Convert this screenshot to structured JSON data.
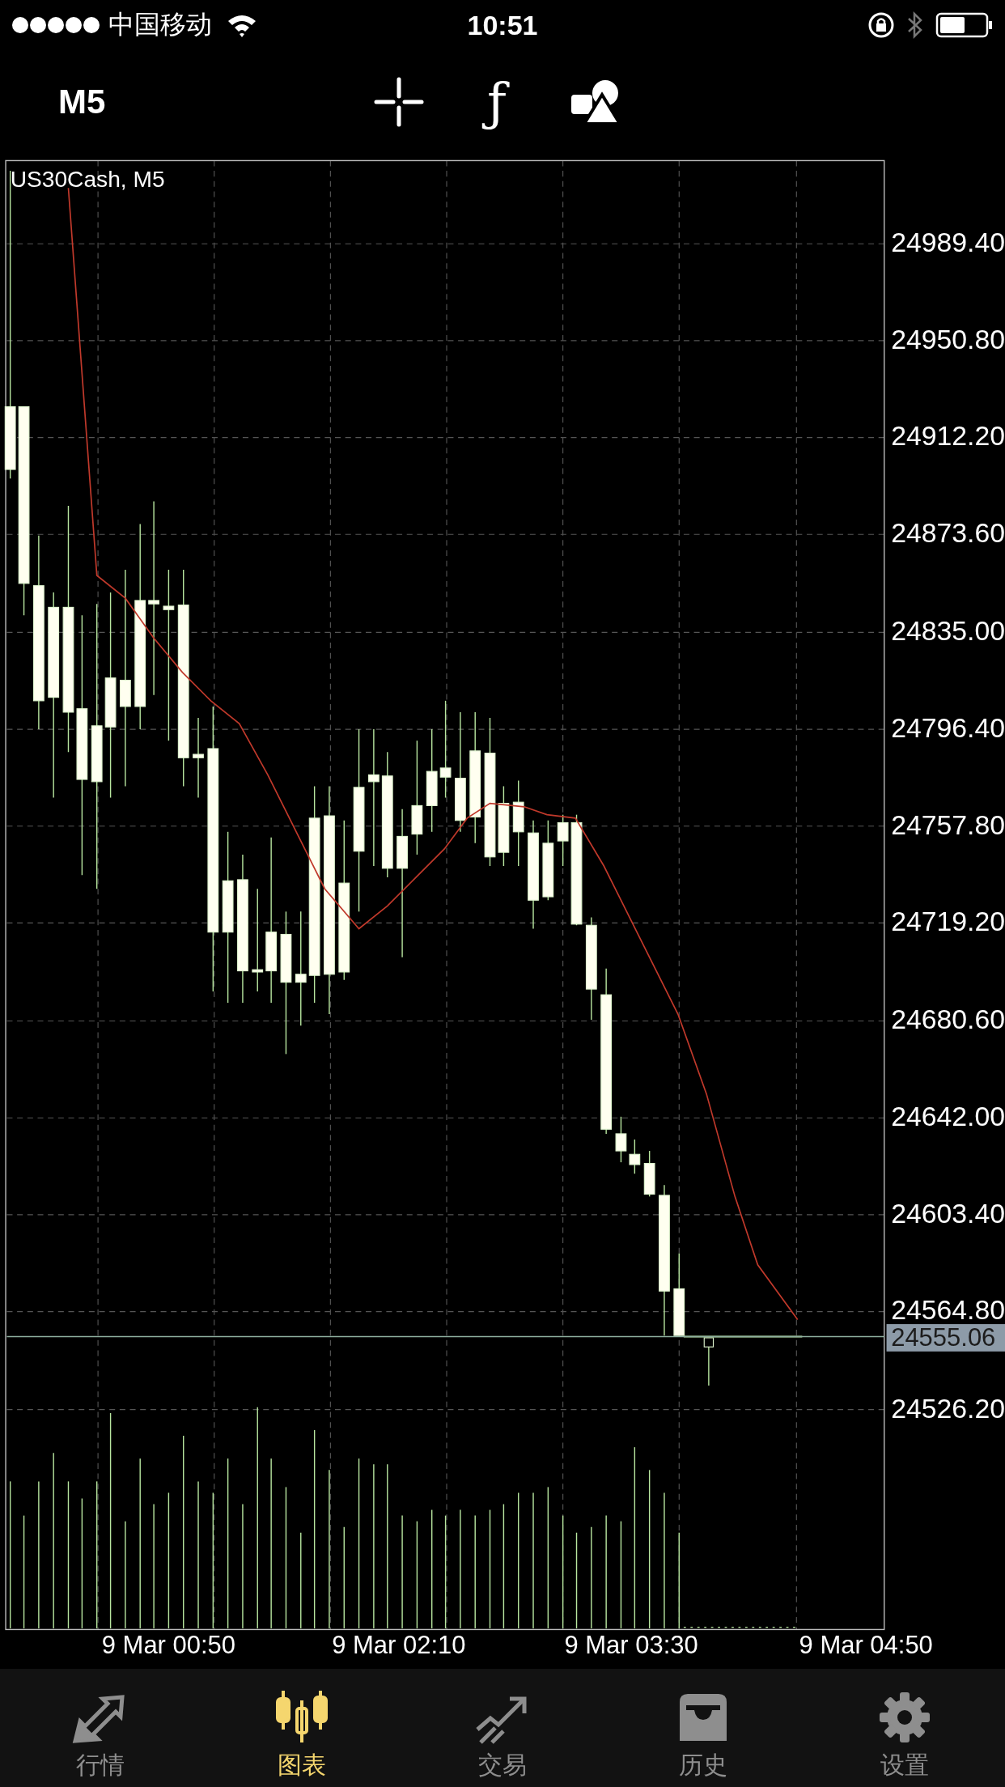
{
  "status_bar": {
    "carrier": "中国移动",
    "time": "10:51"
  },
  "toolbar": {
    "timeframe": "M5",
    "function_glyph": "ƒ"
  },
  "chart": {
    "symbol": "US30Cash, M5",
    "y_labels": [
      "24989.40",
      "24950.80",
      "24912.20",
      "24873.60",
      "24835.00",
      "24796.40",
      "24757.80",
      "24719.20",
      "24680.60",
      "24642.00",
      "24603.40",
      "24564.80",
      "24526.20"
    ],
    "current_price": "24555.06",
    "x_labels": [
      "9 Mar 00:50",
      "9 Mar 02:10",
      "9 Mar 03:30",
      "9 Mar 04:50"
    ]
  },
  "tabs": [
    {
      "label": "行情",
      "selected": false
    },
    {
      "label": "图表",
      "selected": true
    },
    {
      "label": "交易",
      "selected": false
    },
    {
      "label": "历史",
      "selected": false
    },
    {
      "label": "设置",
      "selected": false
    }
  ]
}
